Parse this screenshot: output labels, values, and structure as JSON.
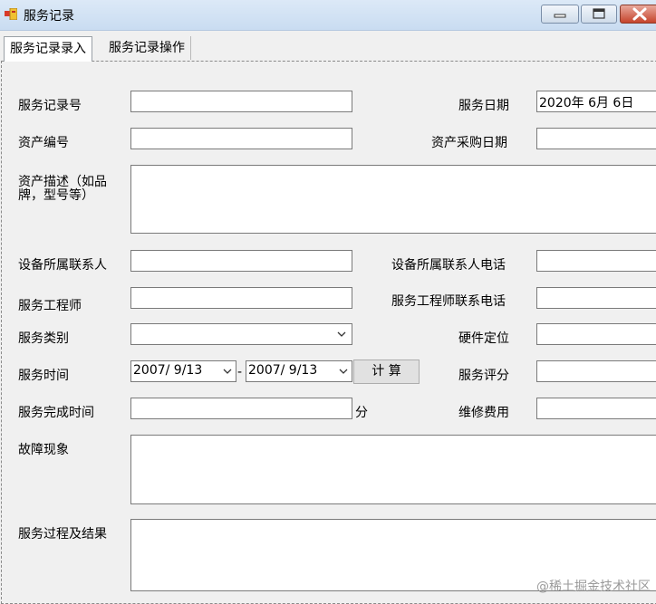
{
  "window": {
    "title": "服务记录"
  },
  "tabs": [
    {
      "label": "服务记录录入"
    },
    {
      "label": "服务记录操作"
    }
  ],
  "form": {
    "record_no_label": "服务记录号",
    "service_date_label": "服务日期",
    "service_date_value": "2020年  6月  6日",
    "asset_no_label": "资产编号",
    "asset_purchase_date_label": "资产采购日期",
    "asset_desc_label": "资产描述（如品牌，型号等）",
    "device_contact_label": "设备所属联系人",
    "device_contact_phone_label": "设备所属联系人电话",
    "engineer_label": "服务工程师",
    "engineer_phone_label": "服务工程师联系电话",
    "service_type_label": "服务类别",
    "hardware_pos_label": "硬件定位",
    "service_time_label": "服务时间",
    "time_from_value": "2007/ 9/13",
    "time_sep": "-",
    "time_to_value": "2007/ 9/13",
    "calc_button": "计 算",
    "rating_label": "服务评分",
    "finish_time_label": "服务完成时间",
    "minutes_unit": "分",
    "repair_cost_label": "维修费用",
    "fault_label": "故障现象",
    "process_label": "服务过程及结果"
  },
  "watermark": "@稀土掘金技术社区"
}
